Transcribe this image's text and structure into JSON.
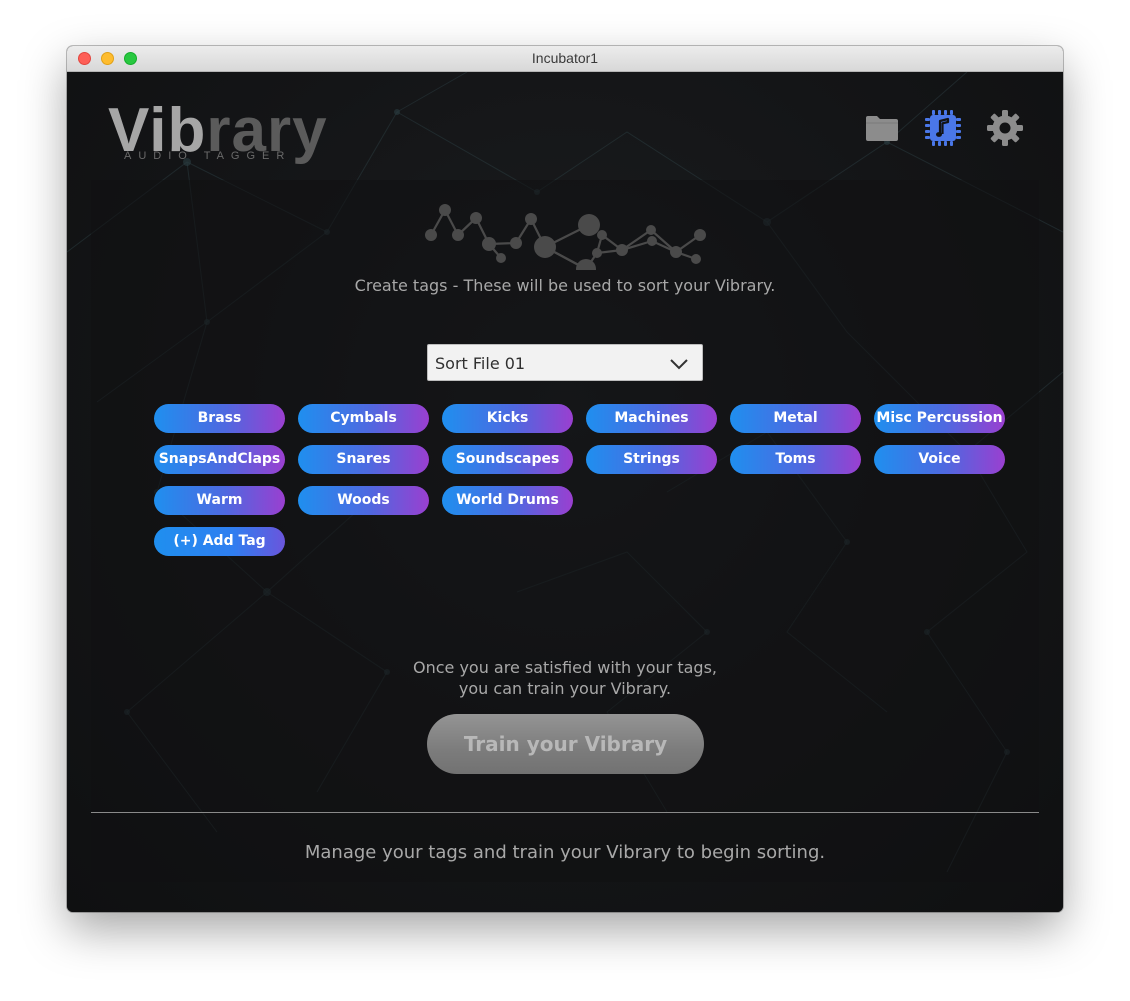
{
  "window": {
    "title": "Incubator1"
  },
  "logo": {
    "part_a": "Vib",
    "part_b": "rary",
    "subtitle": "AUDIO TAGGER"
  },
  "header_icons": [
    "folder-icon",
    "chip-music-icon",
    "gear-icon"
  ],
  "colors": {
    "tag_gradient_start": "#1f8fef",
    "tag_gradient_end": "#9a3fd0",
    "chip_icon": "#4a77e8",
    "background": "#141517"
  },
  "main": {
    "instruction": "Create tags - These will be used to sort your Vibrary.",
    "sort_file": {
      "selected": "Sort File 01"
    },
    "tags": [
      "Brass",
      "Cymbals",
      "Kicks",
      "Machines",
      "Metal",
      "Misc Percussion",
      "SnapsAndClaps",
      "Snares",
      "Soundscapes",
      "Strings",
      "Toms",
      "Voice",
      "Warm",
      "Woods",
      "World Drums"
    ],
    "add_tag_label": "(+) Add Tag",
    "train_note_line1": "Once you are satisfied with your tags,",
    "train_note_line2": "you can train your Vibrary.",
    "train_button_label": "Train your Vibrary"
  },
  "footer": {
    "status": "Manage your tags and train your Vibrary to begin sorting."
  }
}
